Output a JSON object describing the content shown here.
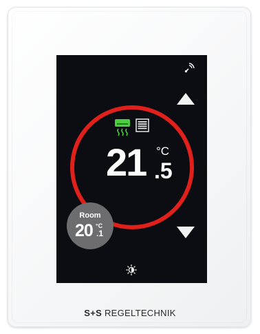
{
  "thermostat": {
    "setpoint": {
      "integer": "21",
      "decimal": ".5",
      "unit": "°C"
    },
    "room": {
      "label": "Room",
      "integer": "20",
      "unit": "°C",
      "decimal": ".1"
    },
    "icons": {
      "signal": "wireless-signal-icon",
      "cooling": "cooling-ac-icon",
      "blinds": "blinds-icon",
      "mode": "sun-brightness-icon",
      "increase": "arrow-up-icon",
      "decrease": "arrow-down-icon"
    },
    "colors": {
      "ring": "#e0201b",
      "cooling": "#4ccc3f",
      "screen": "#0b0d12",
      "room_badge": "#6d6d6f"
    }
  },
  "brand": {
    "prefix": "S+S",
    "name": "REGELTECHNIK"
  }
}
